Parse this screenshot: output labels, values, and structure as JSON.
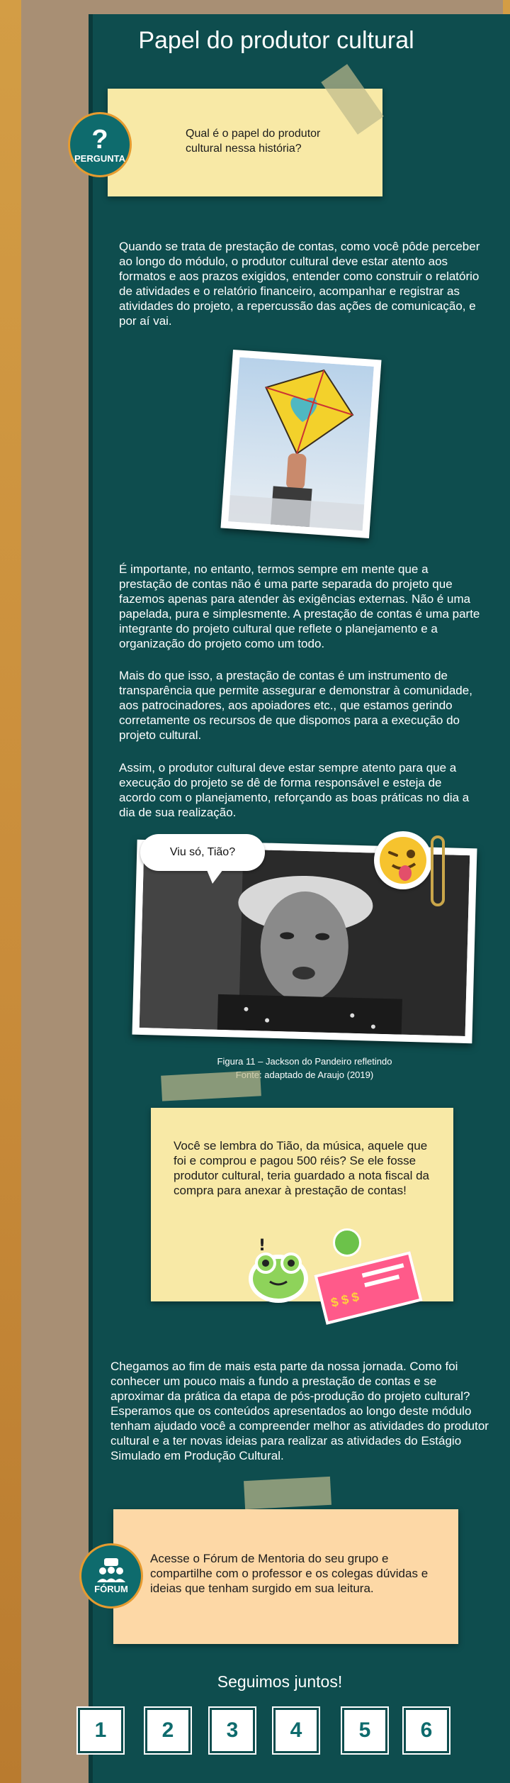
{
  "page": {
    "title": "Papel do produtor cultural"
  },
  "question": {
    "badge_label": "PERGUNTA",
    "badge_icon": "question-mark-icon",
    "text": "Qual é o papel do produtor cultural nessa história?"
  },
  "paragraphs": {
    "p1": "Quando se trata de prestação de contas, como você pôde perceber ao longo do módulo, o produtor cultural deve estar atento aos formatos e aos prazos exigidos, entender como construir o relatório de atividades e o relatório financeiro, acompanhar e registrar as atividades do projeto, a repercussão das ações de comunicação, e por aí vai.",
    "p2": "É importante, no entanto, termos sempre em mente que a prestação de contas não é uma parte separada do projeto que fazemos apenas para atender às exigências externas. Não é uma papelada, pura e simplesmente. A prestação de contas é uma parte integrante do projeto cultural que reflete o planejamento e a organização do projeto como um todo.",
    "p3": "Mais do que isso, a prestação de contas é um instrumento de transparência que permite assegurar e demonstrar à comunidade, aos patrocinadores, aos apoiadores etc., que estamos gerindo corretamente os recursos de que dispomos para a execução do projeto cultural.",
    "p4": "Assim, o produtor cultural deve estar sempre atento para que a execução do projeto se dê de forma responsável e esteja de acordo com o planejamento, reforçando as boas práticas no dia a dia de sua realização.",
    "p5": "Chegamos ao fim de mais esta parte da nossa jornada. Como foi conhecer um pouco mais a fundo a prestação de contas e se aproximar da prática da etapa de pós-produção do projeto cultural? Esperamos que os conteúdos apresentados ao longo deste módulo tenham ajudado você a compreender melhor as atividades do produtor cultural e a ter novas ideias para realizar as atividades do Estágio Simulado em Produção Cultural."
  },
  "figure": {
    "speech": "Viu só, Tião?",
    "caption_line1": "Figura 11 – Jackson do Pandeiro refletindo",
    "caption_line2": "Fonte: adaptado de Araujo (2019)"
  },
  "tiao_note": {
    "text": "Você se lembra do Tião, da música, aquele que foi e comprou e pagou 500 réis? Se ele fosse produtor cultural, teria guardado a nota fiscal da compra para anexar à prestação de contas!",
    "receipt_text": "$ $ $"
  },
  "forum": {
    "badge_label": "FÓRUM",
    "badge_icon": "group-chat-icon",
    "text": "Acesse o Fórum de Mentoria do seu grupo e compartilhe com o professor e os colegas dúvidas e ideias que tenham surgido em sua leitura."
  },
  "footer": {
    "closing": "Seguimos juntos!",
    "pages": [
      "1",
      "2",
      "3",
      "4",
      "5",
      "6"
    ]
  },
  "colors": {
    "panel": "#0e4d4e",
    "accent": "#e69b2f",
    "note_yellow": "#f8e9a6",
    "note_peach": "#fdd8a6"
  }
}
